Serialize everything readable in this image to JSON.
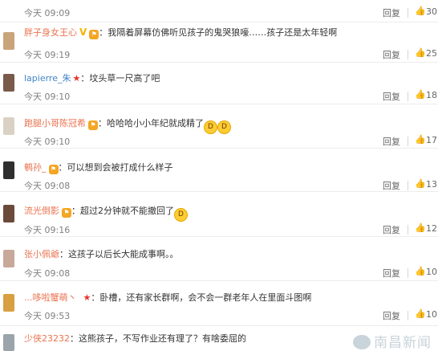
{
  "rows": [
    {
      "user": "",
      "time": "今天 09:09",
      "reply": "回复",
      "likes": "30",
      "text": ""
    },
    {
      "user": "胖子身女王心",
      "text": "：我隔着屏幕仿佛听见孩子的鬼哭狼嚎……孩子还是太年轻啊",
      "time": "今天 09:19",
      "reply": "回复",
      "likes": "25"
    },
    {
      "user": "lapierre_朱",
      "text": "：坟头草一尺高了吧",
      "time": "今天 09:10",
      "reply": "回复",
      "likes": "18"
    },
    {
      "user": "跑腿小哥陈冠希",
      "text": "：哈哈哈小小年纪就成精了",
      "time": "今天 09:10",
      "reply": "回复",
      "likes": "17"
    },
    {
      "user": "鹌孙_",
      "text": "：可以想到会被打成什么样子",
      "time": "今天 09:08",
      "reply": "回复",
      "likes": "13"
    },
    {
      "user": "流光倒影",
      "text": "：超过2分钟就不能撤回了",
      "time": "今天 09:16",
      "reply": "回复",
      "likes": "12"
    },
    {
      "user": "张小佩爺",
      "text": "：这孩子以后长大能成事啊。。",
      "time": "今天 09:08",
      "reply": "回复",
      "likes": "10"
    },
    {
      "user": "...哆啦蟹萌丶",
      "text": "：卧槽，还有家长群啊，会不会一群老年人在里面斗图啊",
      "time": "今天 09:53",
      "reply": "回复",
      "likes": "10"
    },
    {
      "user": "少侠23232",
      "text": "：这熊孩子，不写作业还有理了？有啥委屈的",
      "time": "",
      "reply": "",
      "likes": ""
    }
  ],
  "watermark": "南昌新闻",
  "icons": {
    "like": "thumbs-up-icon",
    "vip": "vip-crown-icon",
    "star": "star-icon",
    "laugh": "laughing-emoji-icon"
  }
}
